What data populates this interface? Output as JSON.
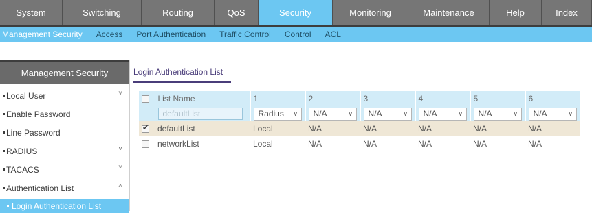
{
  "topnav": {
    "items": [
      {
        "label": "System",
        "active": false
      },
      {
        "label": "Switching",
        "active": false
      },
      {
        "label": "Routing",
        "active": false
      },
      {
        "label": "QoS",
        "active": false
      },
      {
        "label": "Security",
        "active": true
      },
      {
        "label": "Monitoring",
        "active": false
      },
      {
        "label": "Maintenance",
        "active": false
      },
      {
        "label": "Help",
        "active": false
      },
      {
        "label": "Index",
        "active": false
      }
    ]
  },
  "subnav": {
    "items": [
      {
        "label": "Management Security",
        "active": true
      },
      {
        "label": "Access",
        "active": false
      },
      {
        "label": "Port Authentication",
        "active": false
      },
      {
        "label": "Traffic Control",
        "active": false
      },
      {
        "label": "Control",
        "active": false
      },
      {
        "label": "ACL",
        "active": false
      }
    ]
  },
  "sidebar": {
    "header": "Management Security",
    "items": [
      {
        "label": "Local User",
        "chevron": "˅"
      },
      {
        "label": "Enable Password",
        "chevron": ""
      },
      {
        "label": "Line Password",
        "chevron": ""
      },
      {
        "label": "RADIUS",
        "chevron": "˅"
      },
      {
        "label": "TACACS",
        "chevron": "˅"
      },
      {
        "label": "Authentication List",
        "chevron": "˄"
      }
    ],
    "subitem": "Login Authentication List"
  },
  "main": {
    "title": "Login Authentication List",
    "table": {
      "headers": [
        "List Name",
        "1",
        "2",
        "3",
        "4",
        "5",
        "6"
      ],
      "input_row": {
        "name_placeholder": "defaultList",
        "methods": [
          "Radius",
          "N/A",
          "N/A",
          "N/A",
          "N/A",
          "N/A"
        ]
      },
      "rows": [
        {
          "checked": true,
          "name": "defaultList",
          "methods": [
            "Local",
            "N/A",
            "N/A",
            "N/A",
            "N/A",
            "N/A"
          ]
        },
        {
          "checked": false,
          "name": "networkList",
          "methods": [
            "Local",
            "N/A",
            "N/A",
            "N/A",
            "N/A",
            "N/A"
          ]
        }
      ]
    }
  },
  "colors": {
    "accent": "#6cc7f2",
    "nav_bg": "#767676",
    "sidebar_header_bg": "#6a6a6a",
    "selected_row_bg": "#efe7d6",
    "title_color": "#4a3d7a"
  }
}
